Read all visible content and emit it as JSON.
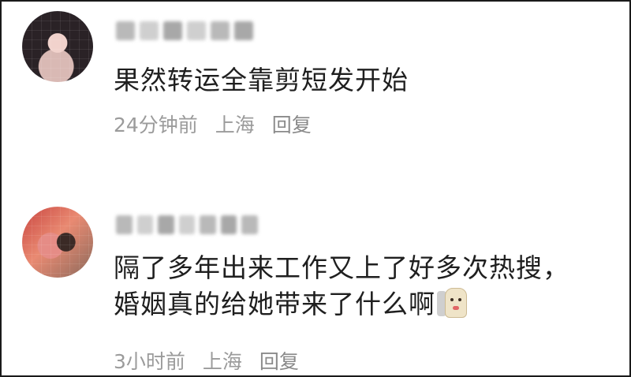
{
  "comments": [
    {
      "text_lines": [
        "果然转运全靠剪短发开始"
      ],
      "time": "24分钟前",
      "location": "上海",
      "reply_label": "回复"
    },
    {
      "text_lines": [
        "隔了多年出来工作又上了好多次热搜，",
        "婚姻真的给她带来了什么啊"
      ],
      "emoji_icon": "meme-sticker-icon",
      "time": "3小时前",
      "location": "上海",
      "reply_label": "回复"
    }
  ]
}
